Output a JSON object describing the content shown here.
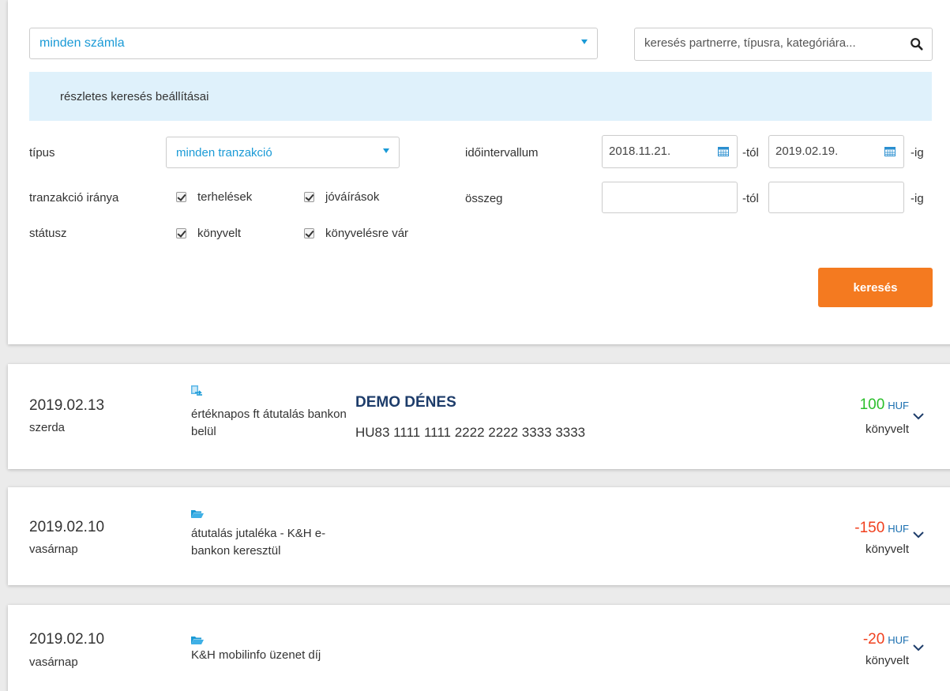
{
  "filter": {
    "account_select": "minden számla",
    "search_placeholder": "keresés partnerre, típusra, kategóriára...",
    "advanced_label": "részletes keresés beállításai",
    "type_label": "típus",
    "type_select": "minden tranzakció",
    "direction_label": "tranzakció iránya",
    "debits_label": "terhelések",
    "credits_label": "jóváírások",
    "status_label": "státusz",
    "booked_label": "könyvelt",
    "pending_label": "könyvelésre vár",
    "interval_label": "időintervallum",
    "date_from": "2018.11.21.",
    "date_to": "2019.02.19.",
    "from_suffix": "-tól",
    "to_suffix": "-ig",
    "amount_label": "összeg",
    "amount_from": "",
    "amount_to": "",
    "search_button": "keresés"
  },
  "transactions": [
    {
      "date": "2019.02.13",
      "day": "szerda",
      "icon": "transfer-icon",
      "type": "értéknapos ft átutalás bankon belül",
      "partner": "DEMO DÉNES",
      "account": "HU83 1111 1111 2222 2222 3333 3333",
      "amount": "100",
      "currency": "HUF",
      "amount_color": "#2bbf2b",
      "status": "könyvelt"
    },
    {
      "date": "2019.02.10",
      "day": "vasárnap",
      "icon": "folder-icon",
      "type": "átutalás jutaléka - K&H e-bankon keresztül",
      "partner": "",
      "account": "",
      "amount": "-150",
      "currency": "HUF",
      "amount_color": "#f0401e",
      "status": "könyvelt"
    },
    {
      "date": "2019.02.10",
      "day": "vasárnap",
      "icon": "folder-icon",
      "type": "K&H mobilinfo üzenet díj",
      "partner": "",
      "account": "",
      "amount": "-20",
      "currency": "HUF",
      "amount_color": "#f0401e",
      "status": "könyvelt"
    }
  ],
  "colors": {
    "accent": "#1a9ad6",
    "button": "#f47a20",
    "banner": "#dff1fb",
    "partner": "#1d3c6a"
  }
}
